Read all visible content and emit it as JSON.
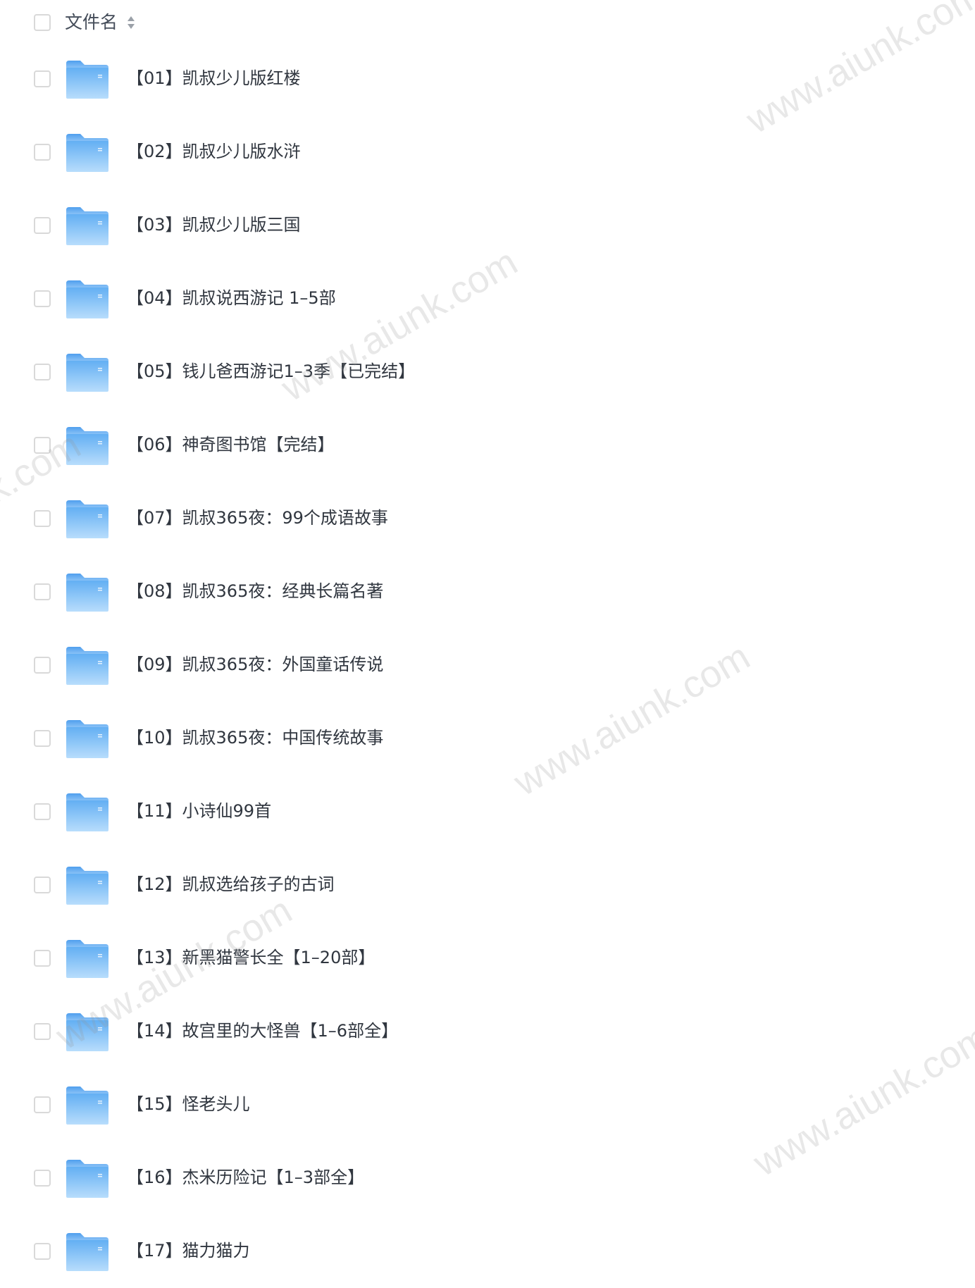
{
  "header": {
    "column_label": "文件名",
    "sort_icon": "sort-icon"
  },
  "folders": [
    {
      "name": "【01】凯叔少儿版红楼"
    },
    {
      "name": "【02】凯叔少儿版水浒"
    },
    {
      "name": "【03】凯叔少儿版三国"
    },
    {
      "name": "【04】凯叔说西游记 1–5部"
    },
    {
      "name": "【05】钱儿爸西游记1–3季【已完结】"
    },
    {
      "name": "【06】神奇图书馆【完结】"
    },
    {
      "name": "【07】凯叔365夜：99个成语故事"
    },
    {
      "name": "【08】凯叔365夜：经典长篇名著"
    },
    {
      "name": "【09】凯叔365夜：外国童话传说"
    },
    {
      "name": "【10】凯叔365夜：中国传统故事"
    },
    {
      "name": "【11】小诗仙99首"
    },
    {
      "name": "【12】凯叔选给孩子的古词"
    },
    {
      "name": "【13】新黑猫警长全【1–20部】"
    },
    {
      "name": "【14】故宫里的大怪兽【1–6部全】"
    },
    {
      "name": "【15】怪老头儿"
    },
    {
      "name": "【16】杰米历险记【1–3部全】"
    },
    {
      "name": "【17】猫力猫力"
    }
  ],
  "watermark": {
    "text": "www.aiunk.com"
  },
  "colors": {
    "folder_top": "#5aa8f0",
    "folder_bottom": "#a9d4fa",
    "checkbox_border": "#d9d9d9",
    "text": "#30363f"
  }
}
